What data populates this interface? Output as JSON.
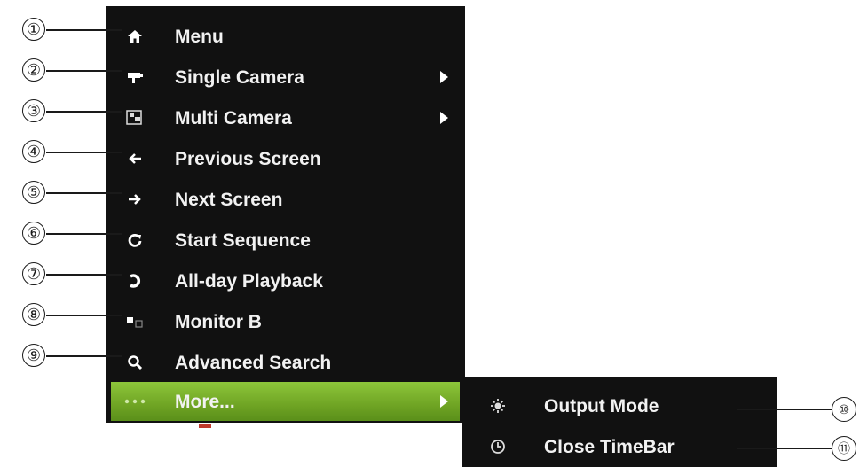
{
  "menu": {
    "items": [
      {
        "label": "Menu",
        "icon": "home-icon",
        "submenu": false
      },
      {
        "label": "Single Camera",
        "icon": "camera-icon",
        "submenu": true
      },
      {
        "label": "Multi Camera",
        "icon": "multi-camera-icon",
        "submenu": true
      },
      {
        "label": "Previous Screen",
        "icon": "arrow-left-icon",
        "submenu": false
      },
      {
        "label": "Next Screen",
        "icon": "arrow-right-icon",
        "submenu": false
      },
      {
        "label": "Start Sequence",
        "icon": "refresh-icon",
        "submenu": false
      },
      {
        "label": "All-day Playback",
        "icon": "playback-icon",
        "submenu": false
      },
      {
        "label": "Monitor B",
        "icon": "monitor-icon",
        "submenu": false
      },
      {
        "label": "Advanced Search",
        "icon": "search-icon",
        "submenu": false
      },
      {
        "label": "More...",
        "icon": "more-icon",
        "submenu": true,
        "highlighted": true
      }
    ]
  },
  "submenu": {
    "items": [
      {
        "label": "Output Mode",
        "icon": "settings-icon"
      },
      {
        "label": "Close TimeBar",
        "icon": "clock-icon"
      }
    ]
  },
  "callouts": [
    "①",
    "②",
    "③",
    "④",
    "⑤",
    "⑥",
    "⑦",
    "⑧",
    "⑨",
    "⑩",
    "⑪"
  ],
  "colors": {
    "menu_bg": "#111111",
    "highlight": "#7cb52c",
    "text": "#f2f2f2"
  }
}
